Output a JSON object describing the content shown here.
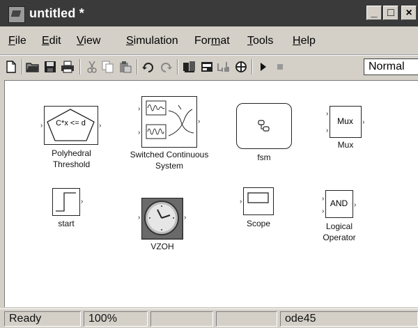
{
  "window": {
    "title": "untitled *"
  },
  "window_controls": {
    "minimize": "_",
    "maximize": "□",
    "close": "×"
  },
  "menu": [
    {
      "label": "File",
      "accel": "F",
      "rest": "ile"
    },
    {
      "label": "Edit",
      "accel": "E",
      "rest": "dit"
    },
    {
      "label": "View",
      "accel": "V",
      "rest": "iew"
    },
    {
      "label": "Simulation",
      "accel": "S",
      "rest": "imulation"
    },
    {
      "label": "Format",
      "pre": "For",
      "accel": "m",
      "rest": "at"
    },
    {
      "label": "Tools",
      "accel": "T",
      "rest": "ools"
    },
    {
      "label": "Help",
      "accel": "H",
      "rest": "elp"
    }
  ],
  "toolbar": {
    "simulation_mode": "Normal"
  },
  "blocks": {
    "polyhedral": {
      "expression": "C*x <= d",
      "caption_line1": "Polyhedral",
      "caption_line2": "Threshold"
    },
    "switched": {
      "caption_line1": "Switched Continuous",
      "caption_line2": "System"
    },
    "fsm": {
      "caption": "fsm"
    },
    "mux": {
      "label": "Mux",
      "caption": "Mux"
    },
    "start": {
      "caption": "start"
    },
    "vzoh": {
      "caption": "VZOH"
    },
    "scope": {
      "caption": "Scope"
    },
    "logical": {
      "label": "AND",
      "caption_line1": "Logical",
      "caption_line2": "Operator"
    }
  },
  "status": {
    "ready": "Ready",
    "zoom": "100%",
    "solver": "ode45"
  }
}
